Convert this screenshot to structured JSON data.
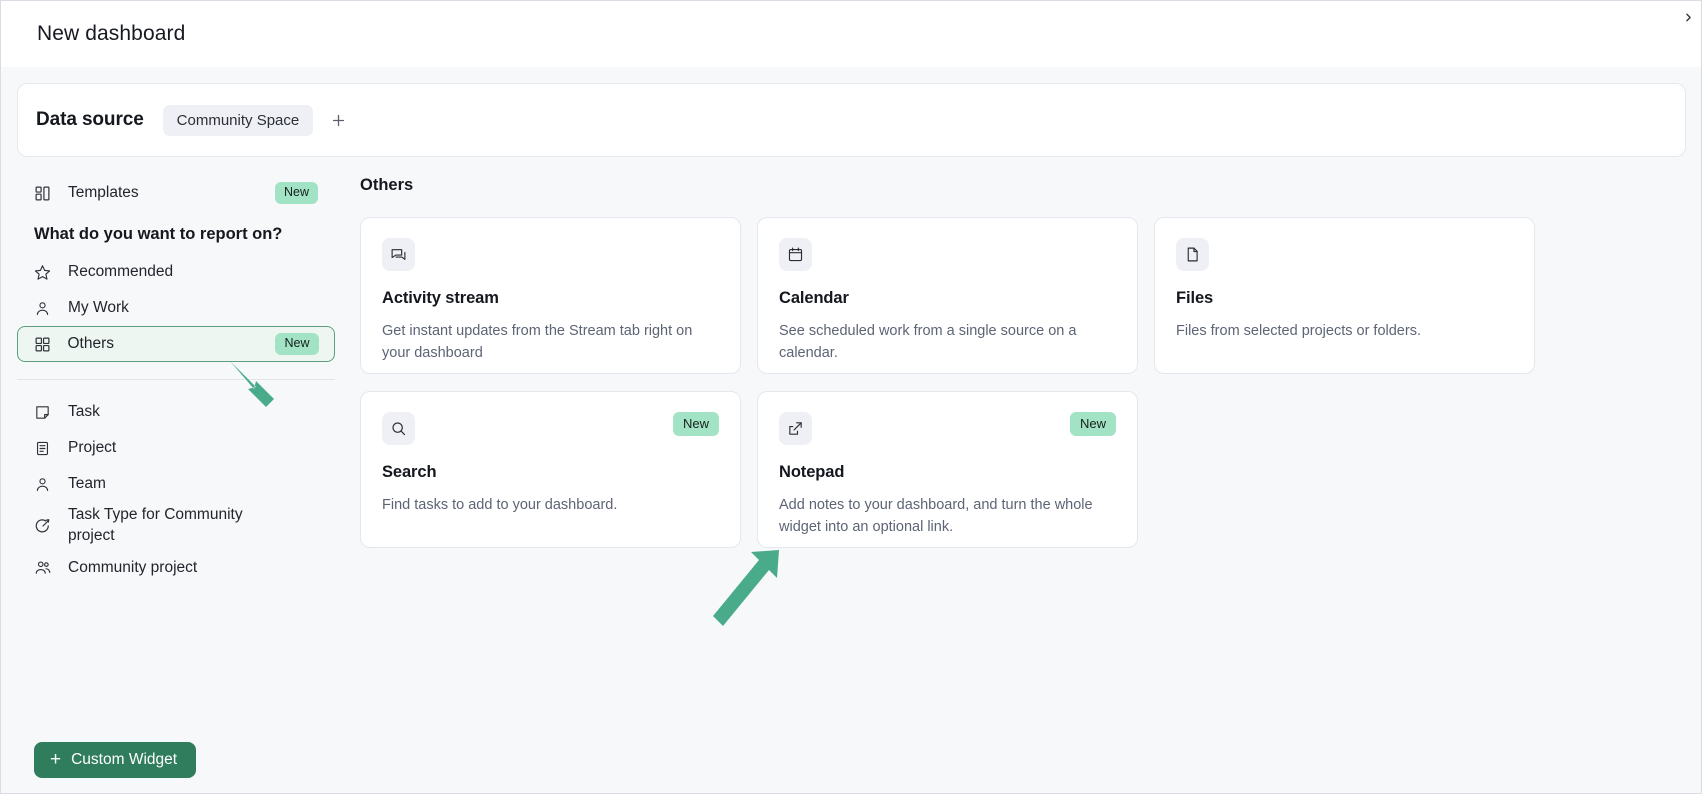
{
  "topbar": {
    "title": "New dashboard",
    "collapse_icon": "chevron-right-icon"
  },
  "datasource": {
    "label": "Data source",
    "chips": [
      "Community Space"
    ],
    "add_icon": "plus-icon"
  },
  "sidebar": {
    "templates": {
      "label": "Templates",
      "badge": "New",
      "icon": "layout-dashboard-icon"
    },
    "question": "What do you want to report on?",
    "primary_items": [
      {
        "label": "Recommended",
        "icon": "star-icon",
        "badge": "",
        "selected": false
      },
      {
        "label": "My Work",
        "icon": "user-icon",
        "badge": "",
        "selected": false
      },
      {
        "label": "Others",
        "icon": "grid-icon",
        "badge": "New",
        "selected": true
      }
    ],
    "secondary_items": [
      {
        "label": "Task",
        "icon": "note-icon"
      },
      {
        "label": "Project",
        "icon": "clipboard-icon"
      },
      {
        "label": "Team",
        "icon": "user-icon"
      },
      {
        "label": "Task Type for Community project",
        "icon": "target-arrow-icon"
      },
      {
        "label": "Community project",
        "icon": "users-group-icon"
      }
    ],
    "custom_widget_button": {
      "label": "Custom Widget",
      "icon": "plus-icon"
    }
  },
  "main": {
    "heading": "Others",
    "cards": [
      {
        "title": "Activity stream",
        "description": "Get instant updates from the Stream tab right on your dashboard",
        "icon": "chat-bubbles-icon",
        "badge": ""
      },
      {
        "title": "Calendar",
        "description": "See scheduled work from a single source on a calendar.",
        "icon": "calendar-icon",
        "badge": ""
      },
      {
        "title": "Files",
        "description": "Files from selected projects or folders.",
        "icon": "file-icon",
        "badge": ""
      },
      {
        "title": "Search",
        "description": "Find tasks to add to your dashboard.",
        "icon": "search-icon",
        "badge": "New"
      },
      {
        "title": "Notepad",
        "description": "Add notes to your dashboard, and turn the whole widget into an optional link.",
        "icon": "external-link-icon",
        "badge": "New"
      }
    ]
  },
  "annotations": {
    "arrow_color": "#4aab8a",
    "arrows": [
      {
        "name": "arrow-pointing-to-others-item"
      },
      {
        "name": "arrow-pointing-to-notepad-card"
      }
    ]
  },
  "colors": {
    "accent_green": "#2f7d5d",
    "badge_green": "#a3e3c5",
    "selected_border": "#5d9e80",
    "page_bg": "#f7f8fa"
  }
}
